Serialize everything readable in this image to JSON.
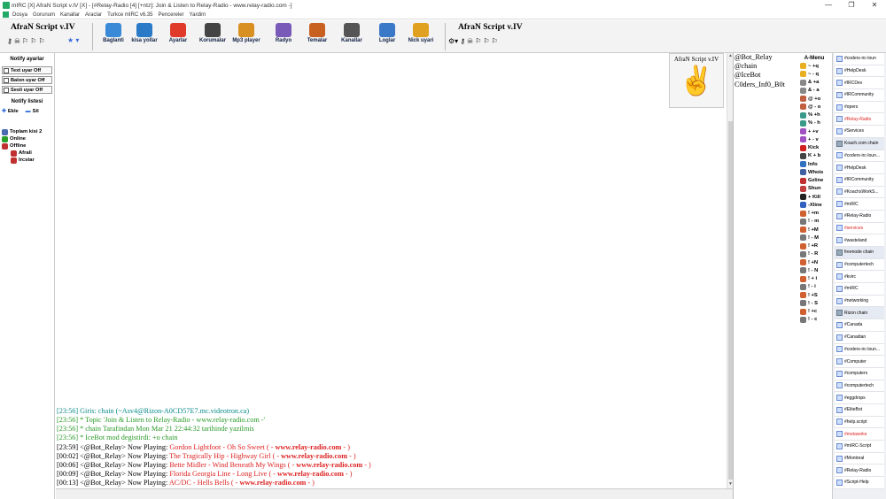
{
  "window": {
    "title": "mIRC [X] AfraN Script v.IV [X] - [#Relay-Radio [4] [+ntz]: Join & Listen to Relay-Radio - www.relay-radio.com -]",
    "buttons": [
      "—",
      "❐",
      "✕"
    ]
  },
  "menu": [
    "Dosya",
    "Gorunum",
    "Kanallar",
    "Araclar",
    "Turkce mIRC v6.35",
    "Pencereler",
    "Yardim"
  ],
  "toolbar": {
    "brand": "AfraN Script v.IV",
    "brand2": "AfraN Script v.IV",
    "buttons": [
      {
        "label": "Baglanti",
        "icon": "globe-icon",
        "color": "#3a8ad8"
      },
      {
        "label": "kisa yollar",
        "icon": "shortcut-icon",
        "color": "#2a7ac8"
      },
      {
        "label": "Ayarlar",
        "icon": "settings-icon",
        "color": "#e03a2a"
      },
      {
        "label": "Korumalar",
        "icon": "shield-icon",
        "color": "#444"
      },
      {
        "label": "Mp3 player",
        "icon": "music-icon",
        "color": "#d89020"
      },
      {
        "label": "Radyo",
        "icon": "radio-icon",
        "color": "#7a5ab8"
      },
      {
        "label": "Temalar",
        "icon": "theme-icon",
        "color": "#c86020"
      },
      {
        "label": "Kanallar",
        "icon": "channels-icon",
        "color": "#555"
      },
      {
        "label": "Loglar",
        "icon": "logs-icon",
        "color": "#3a78c8"
      },
      {
        "label": "Nick uyari",
        "icon": "warning-icon",
        "color": "#e0a020"
      }
    ]
  },
  "left_panel": {
    "header": "Notify ayarlar",
    "toggles": [
      "Text uyar Off",
      "Balon uyar Off",
      "Sesli uyar Off"
    ],
    "notify_header": "Notify listesi",
    "add": "Ekle",
    "remove": "Sil",
    "total": "Toplam kisi 2",
    "online": "Online",
    "offline": "Offline",
    "users": [
      "Afrali",
      "Ircstar"
    ]
  },
  "chat": {
    "lines": [
      {
        "parts": [
          {
            "t": "[23:56] Giris: chain (~Asv4@Rizon-A0CD57E7.mc.videotron.ca)",
            "c": "c-teal"
          }
        ]
      },
      {
        "parts": [
          {
            "t": "[23:56] * Topic 'Join & Listen to Relay-Radio - www.relay-radio.com -'",
            "c": "c-green"
          }
        ]
      },
      {
        "parts": [
          {
            "t": "[23:56] * chain Tarafindan Mon Mar 21 22:44:32 tarihinde yazilmis",
            "c": "c-green"
          }
        ]
      },
      {
        "parts": [
          {
            "t": "[23:56] * IceBot mod degistirdi: +o chain",
            "c": "c-green"
          }
        ]
      },
      {
        "parts": [
          {
            "t": "[23:59] <@Bot_Relay>  Now Playing: ",
            "c": "c-blk"
          },
          {
            "t": "Gordon Lightfoot - Oh So Sweet ( - ",
            "c": "c-red"
          },
          {
            "t": "www.relay-radio.com",
            "c": "c-bold"
          },
          {
            "t": " - )",
            "c": "c-red"
          }
        ]
      },
      {
        "parts": [
          {
            "t": "[00:02] <@Bot_Relay>  Now Playing: ",
            "c": "c-blk"
          },
          {
            "t": "The Tragically Hip - Highway Girl ( - ",
            "c": "c-red"
          },
          {
            "t": "www.relay-radio.com",
            "c": "c-bold"
          },
          {
            "t": " - )",
            "c": "c-red"
          }
        ]
      },
      {
        "parts": [
          {
            "t": "[00:06] <@Bot_Relay>  Now Playing: ",
            "c": "c-blk"
          },
          {
            "t": "Bette Midler - Wind Beneath My Wings ( - ",
            "c": "c-red"
          },
          {
            "t": "www.relay-radio.com",
            "c": "c-bold"
          },
          {
            "t": " - )",
            "c": "c-red"
          }
        ]
      },
      {
        "parts": [
          {
            "t": "[00:09] <@Bot_Relay>  Now Playing: ",
            "c": "c-blk"
          },
          {
            "t": "Florida Georgia Line - Long Live ( - ",
            "c": "c-red"
          },
          {
            "t": "www.relay-radio.com",
            "c": "c-bold"
          },
          {
            "t": " - )",
            "c": "c-red"
          }
        ]
      },
      {
        "parts": [
          {
            "t": "[00:13] <@Bot_Relay>  Now Playing: ",
            "c": "c-blk"
          },
          {
            "t": "AC/DC - Hells Bells ( - ",
            "c": "c-red"
          },
          {
            "t": "www.relay-radio.com",
            "c": "c-bold"
          },
          {
            "t": " - )",
            "c": "c-red"
          }
        ]
      }
    ]
  },
  "logo": {
    "text": "AfraN Script v.IV",
    "glyph": "✌"
  },
  "nicklist": [
    "@Bot_Relay",
    "@chain",
    "@IceBot",
    "C0ders_Inf0_B0t"
  ],
  "amenu": {
    "header": "A-Menu",
    "items": [
      {
        "l": "~ +q",
        "c": "#e8b020"
      },
      {
        "l": "~ - q",
        "c": "#e8b020"
      },
      {
        "l": "& +a",
        "c": "#888"
      },
      {
        "l": "& - a",
        "c": "#888"
      },
      {
        "l": "@ +o",
        "c": "#c06040"
      },
      {
        "l": "@ - o",
        "c": "#c06040"
      },
      {
        "l": "% +h",
        "c": "#3a9a8a"
      },
      {
        "l": "% - h",
        "c": "#3a9a8a"
      },
      {
        "l": "+ +v",
        "c": "#a050c0"
      },
      {
        "l": "+ - v",
        "c": "#a050c0"
      },
      {
        "l": "Kick",
        "c": "#d02020"
      },
      {
        "l": "K + b",
        "c": "#444"
      },
      {
        "l": "Info",
        "c": "#3070c0"
      },
      {
        "l": "Whois",
        "c": "#4060a0"
      },
      {
        "l": "Gzline",
        "c": "#c03030"
      },
      {
        "l": "Shun",
        "c": "#c04040"
      },
      {
        "l": "+ Kill",
        "c": "#222"
      },
      {
        "l": "-Xline",
        "c": "#3060c0"
      },
      {
        "l": "! +m",
        "c": "#d06030"
      },
      {
        "l": "! - m",
        "c": "#777"
      },
      {
        "l": "! +M",
        "c": "#d06030"
      },
      {
        "l": "! - M",
        "c": "#777"
      },
      {
        "l": "! +R",
        "c": "#d06030"
      },
      {
        "l": "! - R",
        "c": "#777"
      },
      {
        "l": "! +N",
        "c": "#d06030"
      },
      {
        "l": "! - N",
        "c": "#777"
      },
      {
        "l": "! + i",
        "c": "#d06030"
      },
      {
        "l": "! - i",
        "c": "#777"
      },
      {
        "l": "! +S",
        "c": "#d06030"
      },
      {
        "l": "! - S",
        "c": "#777"
      },
      {
        "l": "! +c",
        "c": "#d06030"
      },
      {
        "l": "! - c",
        "c": "#777"
      }
    ]
  },
  "tree": [
    {
      "l": "#coders-irc-loun",
      "net": false,
      "red": false
    },
    {
      "l": "#HelpDesk",
      "net": false,
      "red": false
    },
    {
      "l": "#IRCDev",
      "net": false,
      "red": false
    },
    {
      "l": "#IRCommunity",
      "net": false,
      "red": false
    },
    {
      "l": "#opers",
      "net": false,
      "red": false
    },
    {
      "l": "#Relay-Radio",
      "net": false,
      "red": true
    },
    {
      "l": "#Services",
      "net": false,
      "red": false
    },
    {
      "l": "Koach.com chain",
      "net": true,
      "red": false
    },
    {
      "l": "#coders-irc-loun...",
      "net": false,
      "red": false
    },
    {
      "l": "#HelpDesk",
      "net": false,
      "red": false
    },
    {
      "l": "#IRCommunity",
      "net": false,
      "red": false
    },
    {
      "l": "#KoachsWorkS...",
      "net": false,
      "red": false
    },
    {
      "l": "#mIRC",
      "net": false,
      "red": false
    },
    {
      "l": "#Relay-Radio",
      "net": false,
      "red": false
    },
    {
      "l": "#services",
      "net": false,
      "red": true
    },
    {
      "l": "#wasteland",
      "net": false,
      "red": false
    },
    {
      "l": "freenode chain",
      "net": true,
      "red": false
    },
    {
      "l": "#computertech",
      "net": false,
      "red": false
    },
    {
      "l": "#kvirc",
      "net": false,
      "red": false
    },
    {
      "l": "#mIRC",
      "net": false,
      "red": false
    },
    {
      "l": "#networking",
      "net": false,
      "red": false
    },
    {
      "l": "Rizon chain",
      "net": true,
      "red": false
    },
    {
      "l": "#Canada",
      "net": false,
      "red": false
    },
    {
      "l": "#Canadian",
      "net": false,
      "red": false
    },
    {
      "l": "#coders-irc-loun...",
      "net": false,
      "red": false
    },
    {
      "l": "#Computer",
      "net": false,
      "red": false
    },
    {
      "l": "#computers",
      "net": false,
      "red": false
    },
    {
      "l": "#computertech",
      "net": false,
      "red": false
    },
    {
      "l": "#eggdrops",
      "net": false,
      "red": false
    },
    {
      "l": "#EliteBot",
      "net": false,
      "red": false
    },
    {
      "l": "#help.script",
      "net": false,
      "red": false
    },
    {
      "l": "#metawoke",
      "net": false,
      "red": true
    },
    {
      "l": "#mIRC-Script",
      "net": false,
      "red": false
    },
    {
      "l": "#Montreal",
      "net": false,
      "red": false
    },
    {
      "l": "#Relay-Radio",
      "net": false,
      "red": false
    },
    {
      "l": "#Script-Help",
      "net": false,
      "red": false
    }
  ]
}
